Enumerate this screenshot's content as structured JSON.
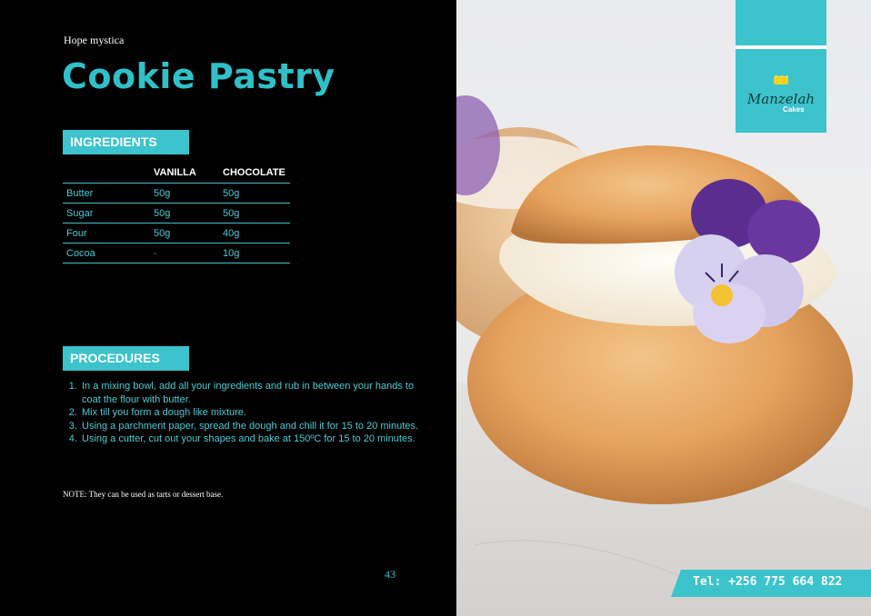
{
  "author": "Hope mystica",
  "title": "Cookie Pastry",
  "ingredients": {
    "label": "INGREDIENTS",
    "columns": [
      "",
      "VANILLA",
      "CHOCOLATE"
    ],
    "rows": [
      [
        "Butter",
        "50g",
        "50g"
      ],
      [
        "Sugar",
        "50g",
        "50g"
      ],
      [
        "Four",
        "50g",
        "40g"
      ],
      [
        "Cocoa",
        "-",
        "10g"
      ]
    ]
  },
  "procedures": {
    "label": "PROCEDURES",
    "steps": [
      "In a mixing bowl, add all your ingredients and rub in between your hands to coat the flour with butter.",
      "Mix till you form a dough like mixture.",
      "Using a parchment paper, spread the dough and chill it for 15 to 20 minutes.",
      "Using a cutter, cut out your shapes and bake at 150ºC for 15 to 20 minutes."
    ]
  },
  "note": "NOTE: They can be used as tarts or dessert base.",
  "page_number": "43",
  "logo": {
    "name": "Manzelah",
    "sub": "Cakes",
    "icon": "cake-icon"
  },
  "contact": {
    "tel": "Tel: +256 775 664 822"
  },
  "colors": {
    "accent": "#3cc3cb",
    "background": "#000000"
  }
}
